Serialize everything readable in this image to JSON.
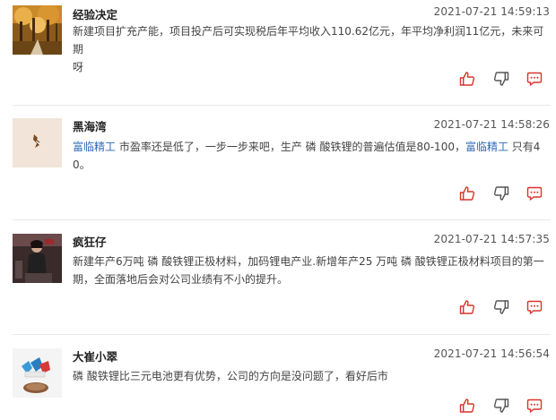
{
  "comments": [
    {
      "username": "经验决定",
      "timestamp": "2021-07-21 14:59:13",
      "text_line1": "新建项目扩充产能，项目投产后可实现税后年平均收入110.62亿元，年平均净利润11亿元，未来可期",
      "text_line2": "呀"
    },
    {
      "username": "黑海湾",
      "timestamp": "2021-07-21 14:58:26",
      "stock1": "富临精工",
      "text_a": " 市盈率还是低了，一步一步来吧，生产 磷 酸铁锂的普遍估值是80-100，",
      "stock2": "富临精工",
      "text_b": " 只有4",
      "text_line2": "0。"
    },
    {
      "username": "疯狂仔",
      "timestamp": "2021-07-21 14:57:35",
      "text_line1": "新建年产6万吨 磷 酸铁锂正极材料，加码锂电产业.新增年产25 万吨 磷 酸铁锂正极材料项目的第一",
      "text_line2": "期，全面落地后会对公司业绩有不小的提升。"
    },
    {
      "username": "大崔小翠",
      "timestamp": "2021-07-21 14:56:54",
      "text_line1": "磷 酸铁锂比三元电池更有优势，公司的方向是没问题了，看好后市"
    }
  ],
  "icons": {
    "like": "thumbs-up-icon",
    "dislike": "thumbs-down-icon",
    "reply": "chat-bubble-icon"
  },
  "colors": {
    "accent": "#d9342b",
    "stock_link": "#2f6ab5",
    "divider": "#e8e8e8"
  }
}
